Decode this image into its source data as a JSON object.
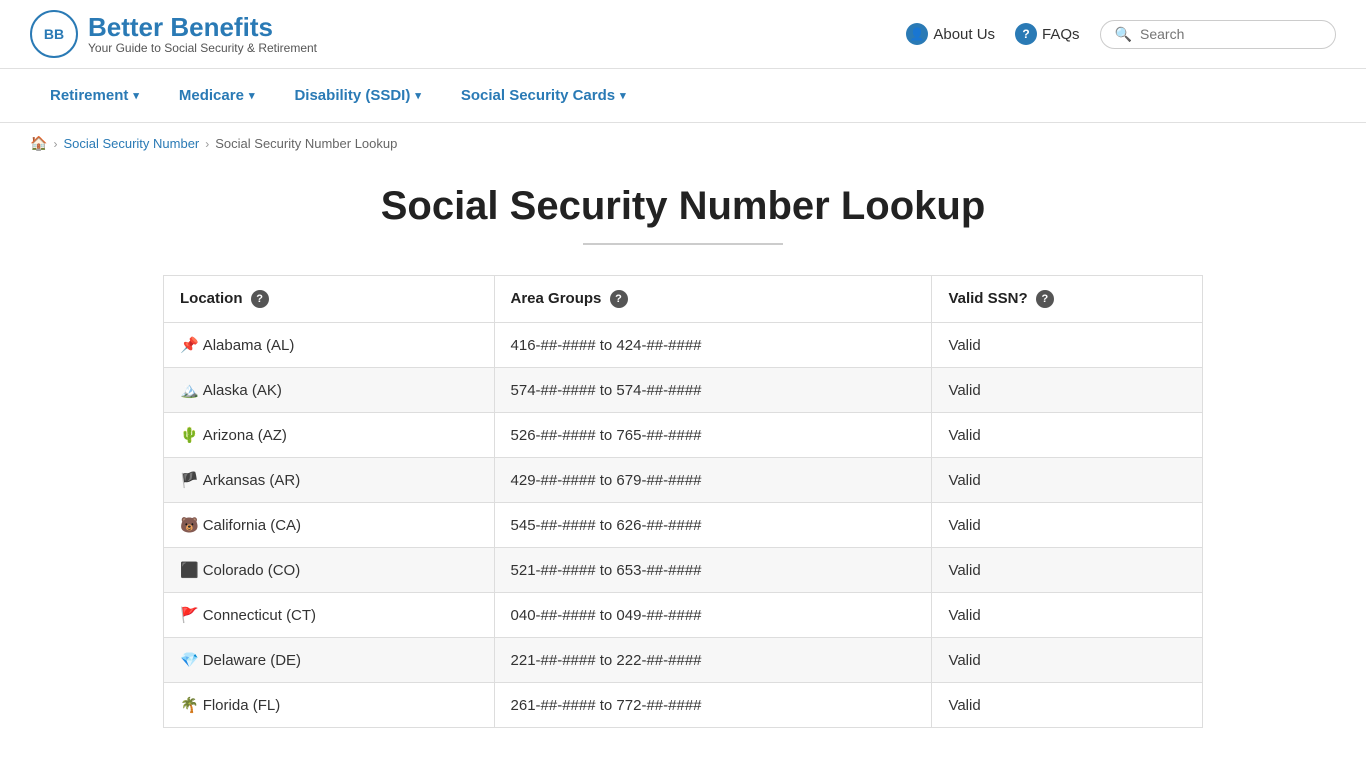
{
  "header": {
    "logo_initials": "BB",
    "logo_title": "Better Benefits",
    "logo_subtitle": "Your Guide to Social Security & Retirement",
    "about_us_label": "About Us",
    "faqs_label": "FAQs",
    "search_placeholder": "Search"
  },
  "nav": {
    "items": [
      {
        "label": "Retirement",
        "has_dropdown": true
      },
      {
        "label": "Medicare",
        "has_dropdown": true
      },
      {
        "label": "Disability (SSDI)",
        "has_dropdown": true
      },
      {
        "label": "Social Security Cards",
        "has_dropdown": true
      }
    ]
  },
  "breadcrumb": {
    "home_icon": "🏠",
    "items": [
      {
        "label": "Social Security Number",
        "href": "#"
      },
      {
        "label": "Social Security Number Lookup",
        "href": "#",
        "current": true
      }
    ]
  },
  "page": {
    "title": "Social Security Number Lookup"
  },
  "table": {
    "headers": [
      {
        "label": "Location",
        "has_help": true
      },
      {
        "label": "Area Groups",
        "has_help": true
      },
      {
        "label": "Valid SSN?",
        "has_help": true
      }
    ],
    "rows": [
      {
        "icon": "📌",
        "location": "Alabama (AL)",
        "area_groups": "416-##-#### to 424-##-####",
        "valid": "Valid"
      },
      {
        "icon": "🏔️",
        "location": "Alaska (AK)",
        "area_groups": "574-##-#### to 574-##-####",
        "valid": "Valid"
      },
      {
        "icon": "🌵",
        "location": "Arizona (AZ)",
        "area_groups": "526-##-#### to 765-##-####",
        "valid": "Valid"
      },
      {
        "icon": "🏴",
        "location": "Arkansas (AR)",
        "area_groups": "429-##-#### to 679-##-####",
        "valid": "Valid"
      },
      {
        "icon": "🐻",
        "location": "California (CA)",
        "area_groups": "545-##-#### to 626-##-####",
        "valid": "Valid"
      },
      {
        "icon": "⬛",
        "location": "Colorado (CO)",
        "area_groups": "521-##-#### to 653-##-####",
        "valid": "Valid"
      },
      {
        "icon": "🚩",
        "location": "Connecticut (CT)",
        "area_groups": "040-##-#### to 049-##-####",
        "valid": "Valid"
      },
      {
        "icon": "💎",
        "location": "Delaware (DE)",
        "area_groups": "221-##-#### to 222-##-####",
        "valid": "Valid"
      },
      {
        "icon": "🌴",
        "location": "Florida (FL)",
        "area_groups": "261-##-#### to 772-##-####",
        "valid": "Valid"
      }
    ]
  }
}
